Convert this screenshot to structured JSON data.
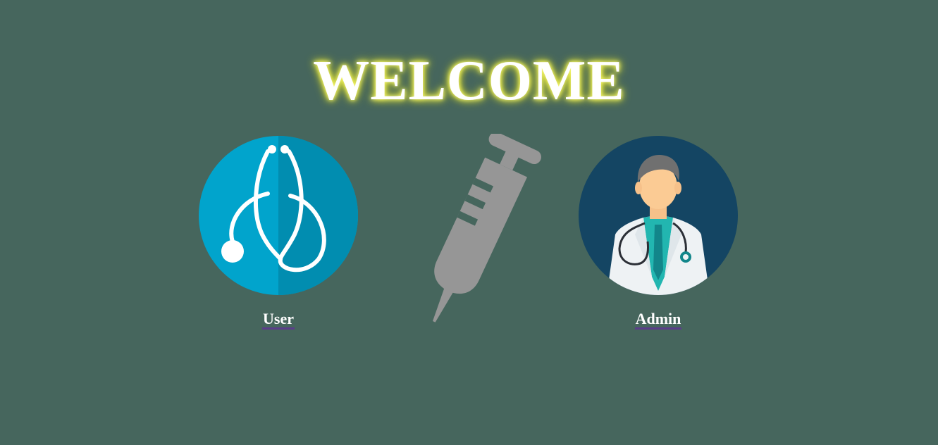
{
  "page": {
    "title": "WELCOME"
  },
  "cards": {
    "user": {
      "label": "User",
      "icon": "stethoscope-icon"
    },
    "admin": {
      "label": "Admin",
      "icon": "doctor-icon"
    }
  },
  "decoration": {
    "icon": "syringe-icon"
  },
  "colors": {
    "background": "#46665d",
    "title_glow": "#e8ea3b",
    "user_circle": "#01a4cc",
    "admin_circle": "#144563",
    "syringe": "#969696"
  }
}
